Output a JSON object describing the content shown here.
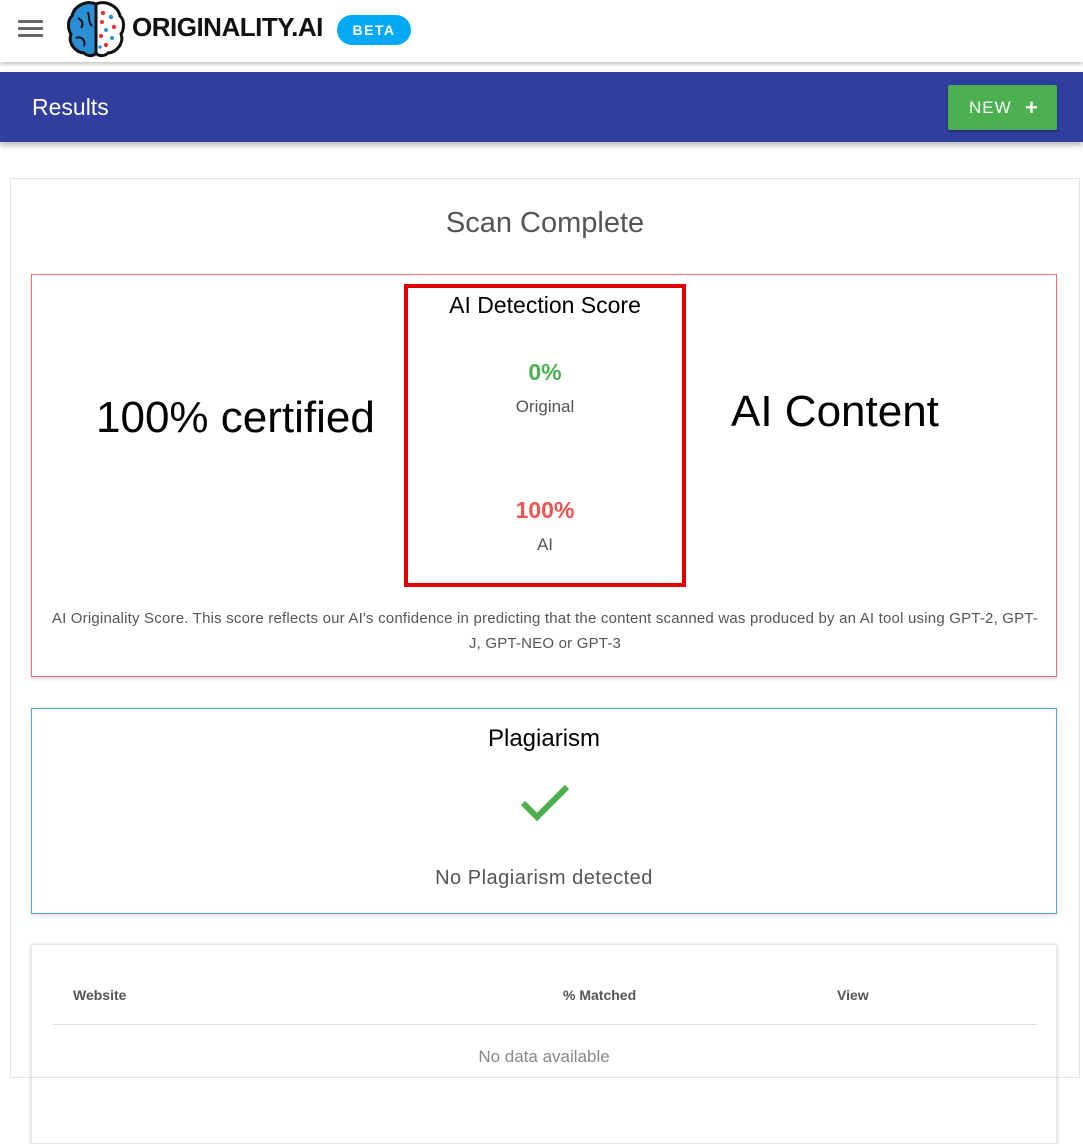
{
  "topbar": {
    "brand": "ORIGINALITY.AI",
    "beta_label": "BETA",
    "menu_icon": "hamburger-menu-icon",
    "logo_icon": "brain-logo-icon"
  },
  "header": {
    "title": "Results",
    "new_button_label": "NEW",
    "new_button_icon": "plus-icon",
    "background_color": "#303f9f",
    "button_color": "#4caf50"
  },
  "scan": {
    "title": "Scan Complete"
  },
  "ai_detection": {
    "annotation_left": "100% certified",
    "annotation_right": "AI Content",
    "title": "AI Detection Score",
    "original_percent": "0%",
    "original_label": "Original",
    "ai_percent": "100%",
    "ai_label": "AI",
    "description": "AI Originality Score. This score reflects our AI's confidence in predicting that the content scanned was produced by an AI tool using GPT-2, GPT-J, GPT-NEO or GPT-3",
    "original_color": "#4caf50",
    "ai_color": "#ef5350",
    "highlight_color": "#e00000"
  },
  "plagiarism": {
    "title": "Plagiarism",
    "status_icon": "checkmark-icon",
    "status_text": "No Plagiarism detected"
  },
  "results_table": {
    "columns": [
      "Website",
      "% Matched",
      "View"
    ],
    "empty_text": "No data available"
  }
}
